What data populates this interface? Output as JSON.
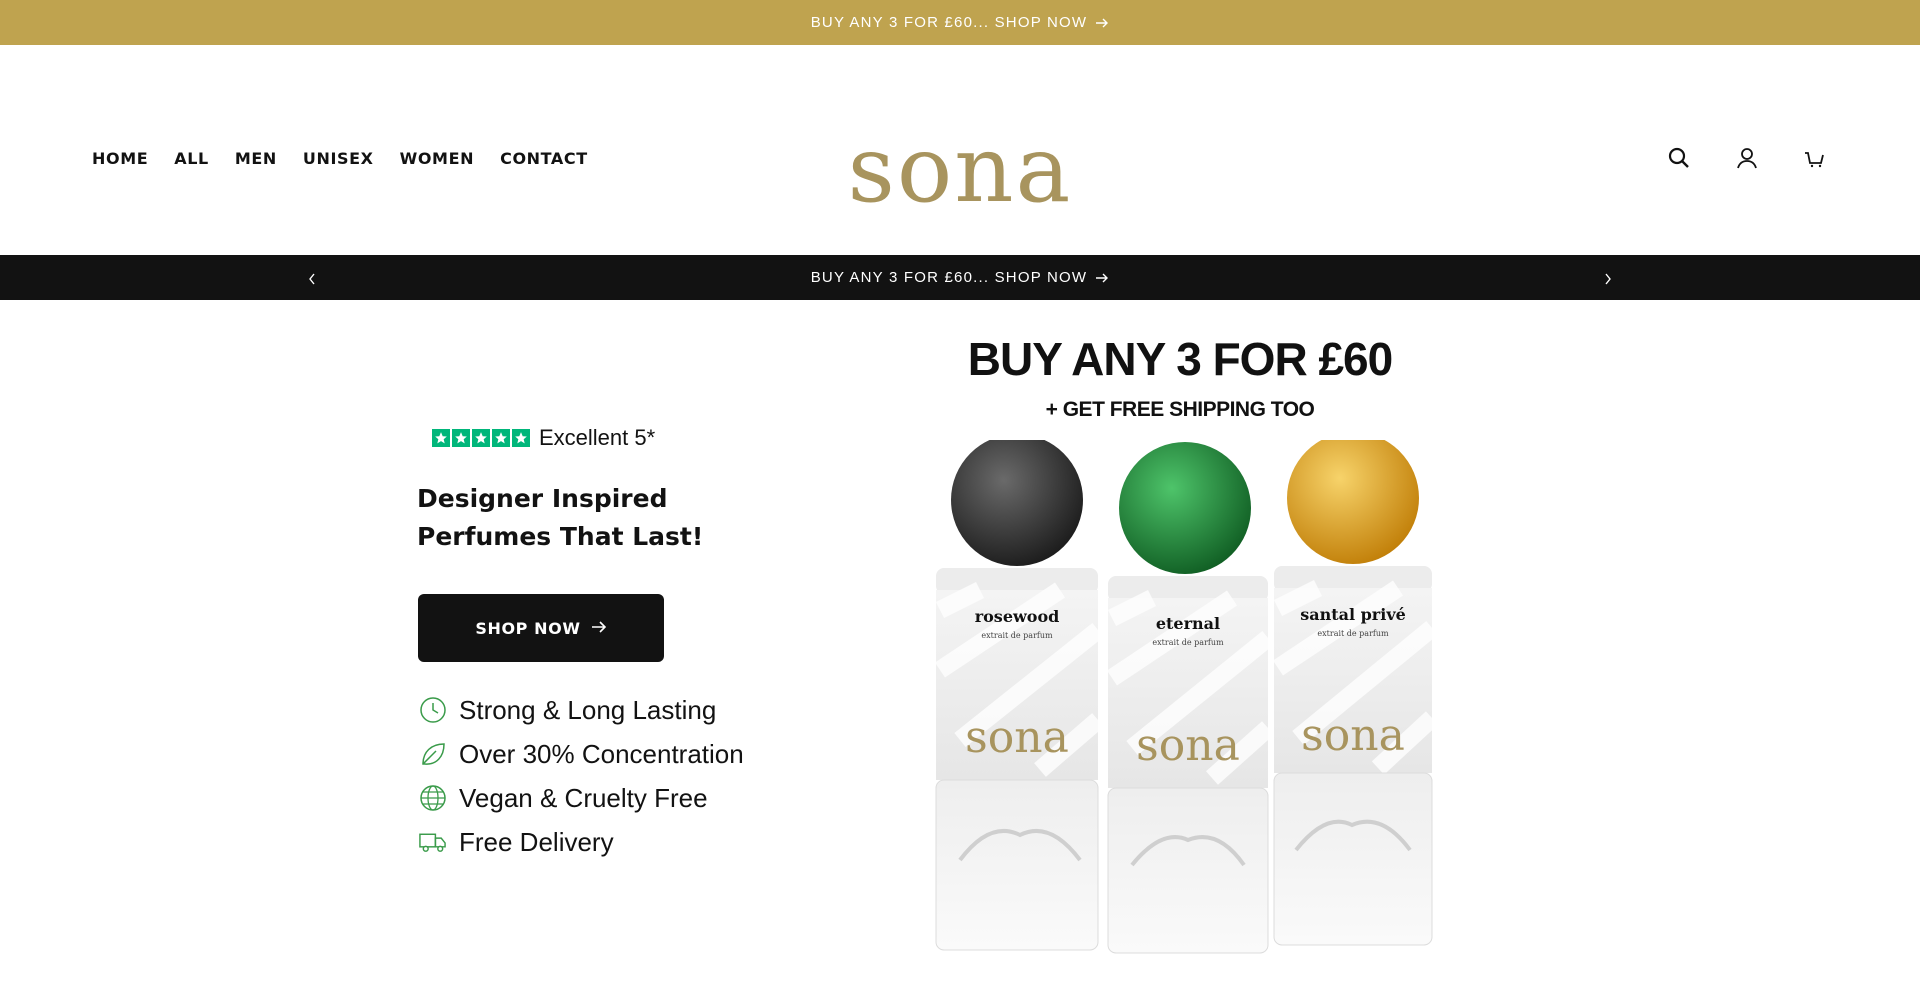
{
  "top_bar": {
    "text": "BUY ANY 3 FOR £60... SHOP NOW"
  },
  "nav": {
    "items": [
      "HOME",
      "ALL",
      "MEN",
      "UNISEX",
      "WOMEN",
      "CONTACT"
    ]
  },
  "logo": {
    "text": "sona"
  },
  "header_icons": [
    "search-icon",
    "account-icon",
    "cart-icon"
  ],
  "announcement": {
    "text": "BUY ANY 3 FOR £60... SHOP NOW"
  },
  "hero": {
    "rating_stars": 5,
    "rating_text": "Excellent 5*",
    "headline": "Designer Inspired Perfumes That Last!",
    "cta_label": "SHOP NOW",
    "features": [
      {
        "icon": "clock-icon",
        "label": "Strong & Long Lasting"
      },
      {
        "icon": "leaf-icon",
        "label": "Over 30% Concentration"
      },
      {
        "icon": "globe-icon",
        "label": "Vegan & Cruelty Free"
      },
      {
        "icon": "delivery-truck-icon",
        "label": "Free Delivery"
      }
    ]
  },
  "promo": {
    "title": "BUY ANY 3 FOR £60",
    "subtitle": "+ GET FREE SHIPPING TOO",
    "bottles": [
      {
        "name": "rosewood",
        "type": "extrait de parfum",
        "brand": "sona",
        "cap_color": "#1e1e1e"
      },
      {
        "name": "eternal",
        "type": "extrait de parfum",
        "brand": "sona",
        "cap_color": "#1f7a34"
      },
      {
        "name": "santal privé",
        "type": "extrait de parfum",
        "brand": "sona",
        "cap_color": "#d99a12"
      }
    ]
  },
  "colors": {
    "gold": "#bfa34f",
    "logo": "#a8945e",
    "dark": "#121212",
    "trustpilot": "#00b67a",
    "feature_icon": "#3a9b4a"
  }
}
